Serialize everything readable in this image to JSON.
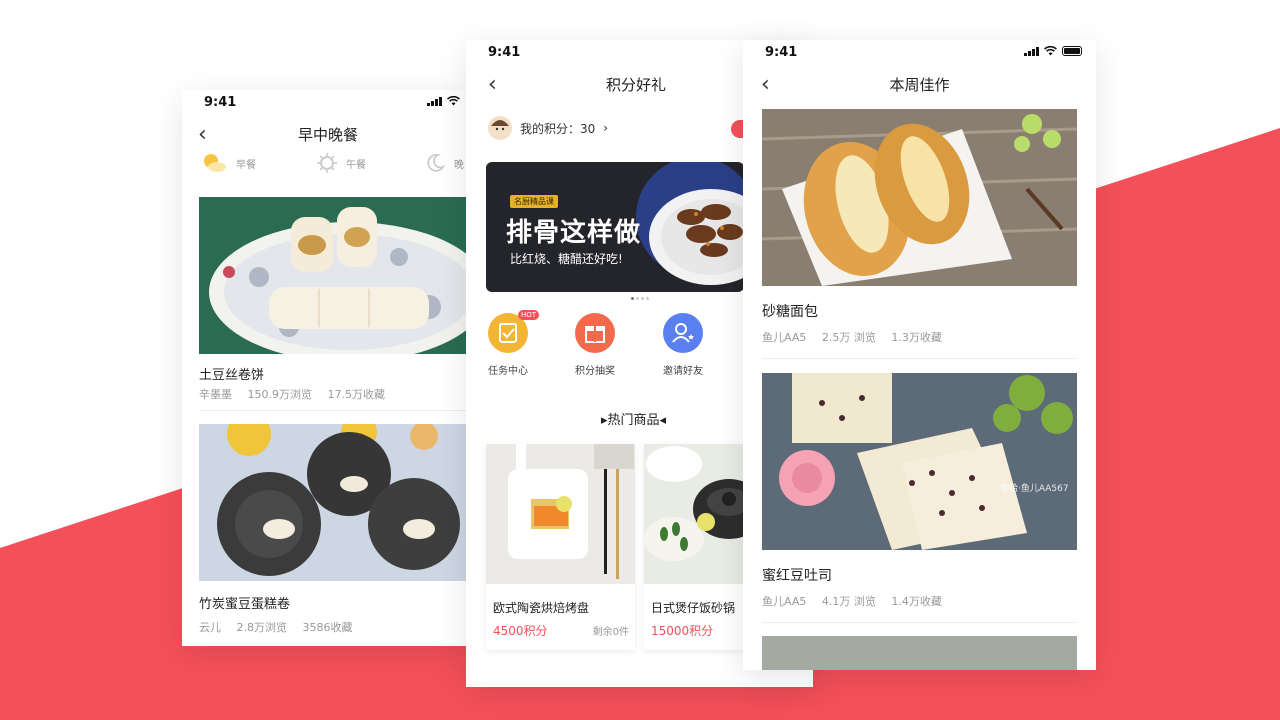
{
  "colors": {
    "accent": "#f4505a",
    "gold": "#e6b325",
    "price": "#f4505a"
  },
  "status_time": "9:41",
  "left_phone": {
    "title": "早中晚餐",
    "meal_tabs": [
      {
        "icon": "sun-cloud-icon",
        "label": "早餐"
      },
      {
        "icon": "sun-icon",
        "label": "午餐"
      },
      {
        "icon": "moon-icon",
        "label": "晚"
      }
    ],
    "recipes": [
      {
        "title": "土豆丝卷饼",
        "author": "辛墨墨",
        "views": "150.9万浏览",
        "favs": "17.5万收藏"
      },
      {
        "title": "竹炭蜜豆蛋糕卷",
        "author": "云儿",
        "views": "2.8万浏览",
        "favs": "3586收藏"
      }
    ]
  },
  "middle_phone": {
    "title": "积分好礼",
    "points_label": "我的积分：30",
    "banner": {
      "tag": "名厨精品课",
      "headline": "排骨这样做",
      "subline": "比红烧、糖醋还好吃!"
    },
    "entries": [
      {
        "label": "任务中心",
        "icon": "task-icon",
        "badge": "HOT"
      },
      {
        "label": "积分抽奖",
        "icon": "gift-icon",
        "badge": ""
      },
      {
        "label": "邀请好友",
        "icon": "invite-icon",
        "badge": ""
      }
    ],
    "hot_title": "▸热门商品◂",
    "products": [
      {
        "name": "欧式陶瓷烘焙烤盘",
        "price": "4500积分",
        "stock": "剩余0件"
      },
      {
        "name": "日式煲仔饭砂锅",
        "price": "15000积分",
        "stock": ""
      }
    ]
  },
  "right_phone": {
    "title": "本周佳作",
    "works": [
      {
        "title": "砂糖面包",
        "author": "鱼儿AA5",
        "views": "2.5万 浏览",
        "favs": "1.3万收藏"
      },
      {
        "title": "蜜红豆吐司",
        "author": "鱼儿AA5",
        "views": "4.1万 浏览",
        "favs": "1.4万收藏",
        "watermark": "香哈·鱼儿AA567"
      }
    ]
  }
}
